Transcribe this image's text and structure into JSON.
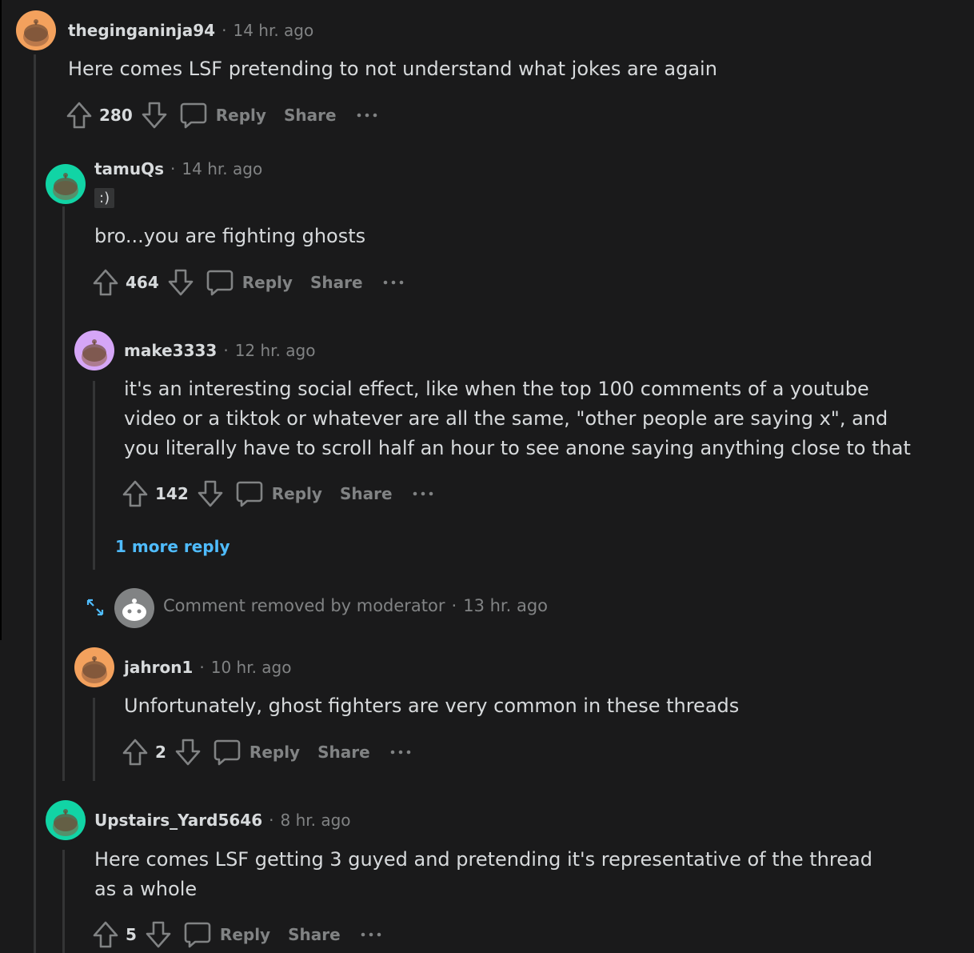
{
  "colors": {
    "background": "#1a1a1b",
    "text": "#d7dadc",
    "muted": "#818384",
    "link": "#4fbcff",
    "avatar_orange": "#f3a15d",
    "avatar_teal": "#11d4a5",
    "avatar_purple": "#d5a6f7",
    "avatar_gray": "#818384"
  },
  "comments": [
    {
      "username": "theginganinja94",
      "time": "14 hr. ago",
      "avatar_color": "orange",
      "text": "Here comes LSF pretending to not understand what jokes are again",
      "score": "280",
      "reply_label": "Reply",
      "share_label": "Share",
      "more_icon": "ellipsis-icon"
    },
    {
      "username": "tamuQs",
      "time": "14 hr. ago",
      "avatar_color": "teal",
      "flair": ":)",
      "text": "bro...you are fighting ghosts",
      "score": "464",
      "reply_label": "Reply",
      "share_label": "Share",
      "more_icon": "ellipsis-icon"
    },
    {
      "username": "make3333",
      "time": "12 hr. ago",
      "avatar_color": "purple",
      "text": "it's an interesting social effect, like when the top 100 comments of a youtube video or a tiktok or whatever are all the same, \"other people are saying x\", and you literally have to scroll half an hour to see anone saying anything close to that",
      "score": "142",
      "reply_label": "Reply",
      "share_label": "Share",
      "more_icon": "ellipsis-icon",
      "more_replies": "1 more reply"
    },
    {
      "removed_text": "Comment removed by moderator",
      "time": "13 hr. ago",
      "expand_icon": "expand-icon"
    },
    {
      "username": "jahron1",
      "time": "10 hr. ago",
      "avatar_color": "orange",
      "text": "Unfortunately, ghost fighters are very common in these threads",
      "score": "2",
      "reply_label": "Reply",
      "share_label": "Share",
      "more_icon": "ellipsis-icon"
    },
    {
      "username": "Upstairs_Yard5646",
      "time": "8 hr. ago",
      "avatar_color": "teal",
      "text": "Here comes LSF getting 3 guyed and pretending it's representative of the thread as a whole",
      "score": "5",
      "reply_label": "Reply",
      "share_label": "Share",
      "more_icon": "ellipsis-icon"
    }
  ],
  "separator": "·"
}
